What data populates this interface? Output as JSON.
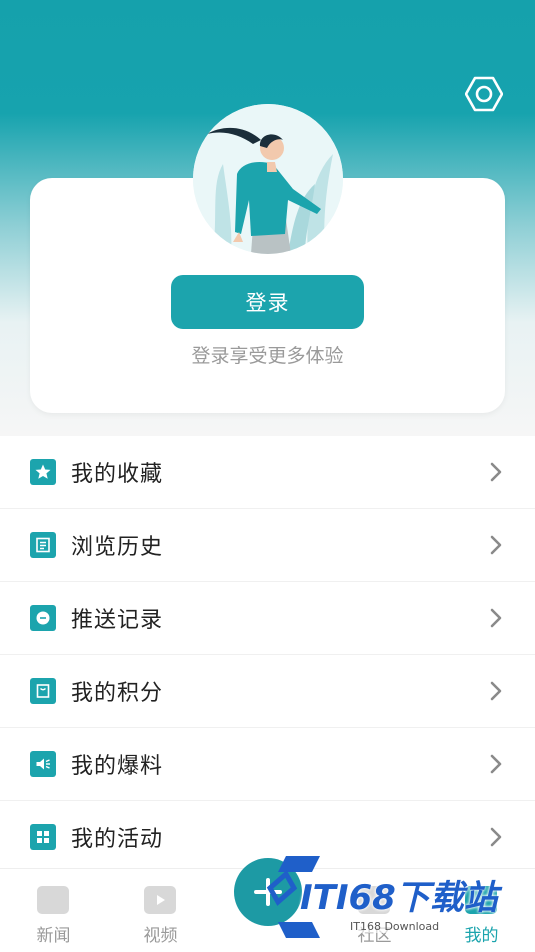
{
  "header": {
    "settings_icon": "hexagon-settings-icon",
    "brand_color": "#15a1ac"
  },
  "profile": {
    "avatar_icon": "woman-illustration-avatar",
    "login_label": "登录",
    "login_hint": "登录享受更多体验"
  },
  "menu": {
    "items": [
      {
        "label": "我的收藏",
        "icon": "star-icon"
      },
      {
        "label": "浏览历史",
        "icon": "history-doc-icon"
      },
      {
        "label": "推送记录",
        "icon": "chat-bubble-icon"
      },
      {
        "label": "我的积分",
        "icon": "points-bag-icon"
      },
      {
        "label": "我的爆料",
        "icon": "speaker-icon"
      },
      {
        "label": "我的活动",
        "icon": "grid-icon"
      }
    ]
  },
  "tabbar": {
    "tabs": [
      {
        "label": "新闻",
        "icon": "news-icon",
        "active": false
      },
      {
        "label": "视频",
        "icon": "video-play-icon",
        "active": false
      },
      {
        "label": "",
        "icon": "add-fab-icon",
        "active": false
      },
      {
        "label": "社区",
        "icon": "community-icon",
        "active": false
      },
      {
        "label": "我的",
        "icon": "profile-icon",
        "active": true
      }
    ]
  },
  "watermark": {
    "text": "ITI68下载站",
    "sub": "IT168 Download"
  }
}
